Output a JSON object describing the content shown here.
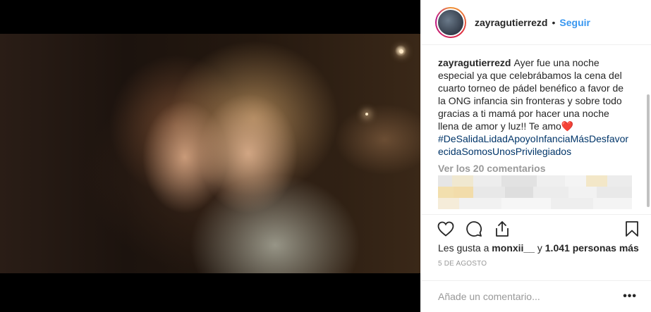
{
  "post": {
    "username": "zayragutierrezd",
    "follow_separator": "•",
    "follow_label": "Seguir"
  },
  "caption": {
    "username": "zayragutierrezd",
    "text": "Ayer fue una noche especial ya que celebrábamos la cena del cuarto torneo de pádel benéfico a favor de la ONG infancia sin fronteras y sobre todo gracias a ti mamá por hacer una noche llena de amor y luz!! Te amo",
    "emoji": "❤️",
    "hashtags": "#DeSalidaLidadApoyoInfanciaMásDesfavorecidaSomosUnosPrivilegiados"
  },
  "comments": {
    "view_all_label": "Ver los 20 comentarios"
  },
  "likes": {
    "prefix": "Les gusta a",
    "first_user": "monxii__",
    "connector": "y",
    "others": "1.041 personas más"
  },
  "date": "5 DE AGOSTO",
  "add_comment": {
    "placeholder": "Añade un comentario...",
    "more_label": "•••"
  },
  "icons": {
    "like": "heart-icon",
    "comment": "comment-icon",
    "share": "share-icon",
    "save": "bookmark-icon"
  },
  "colors": {
    "follow": "#3897f0",
    "hashtag": "#003569",
    "muted": "#999999",
    "text": "#262626"
  }
}
